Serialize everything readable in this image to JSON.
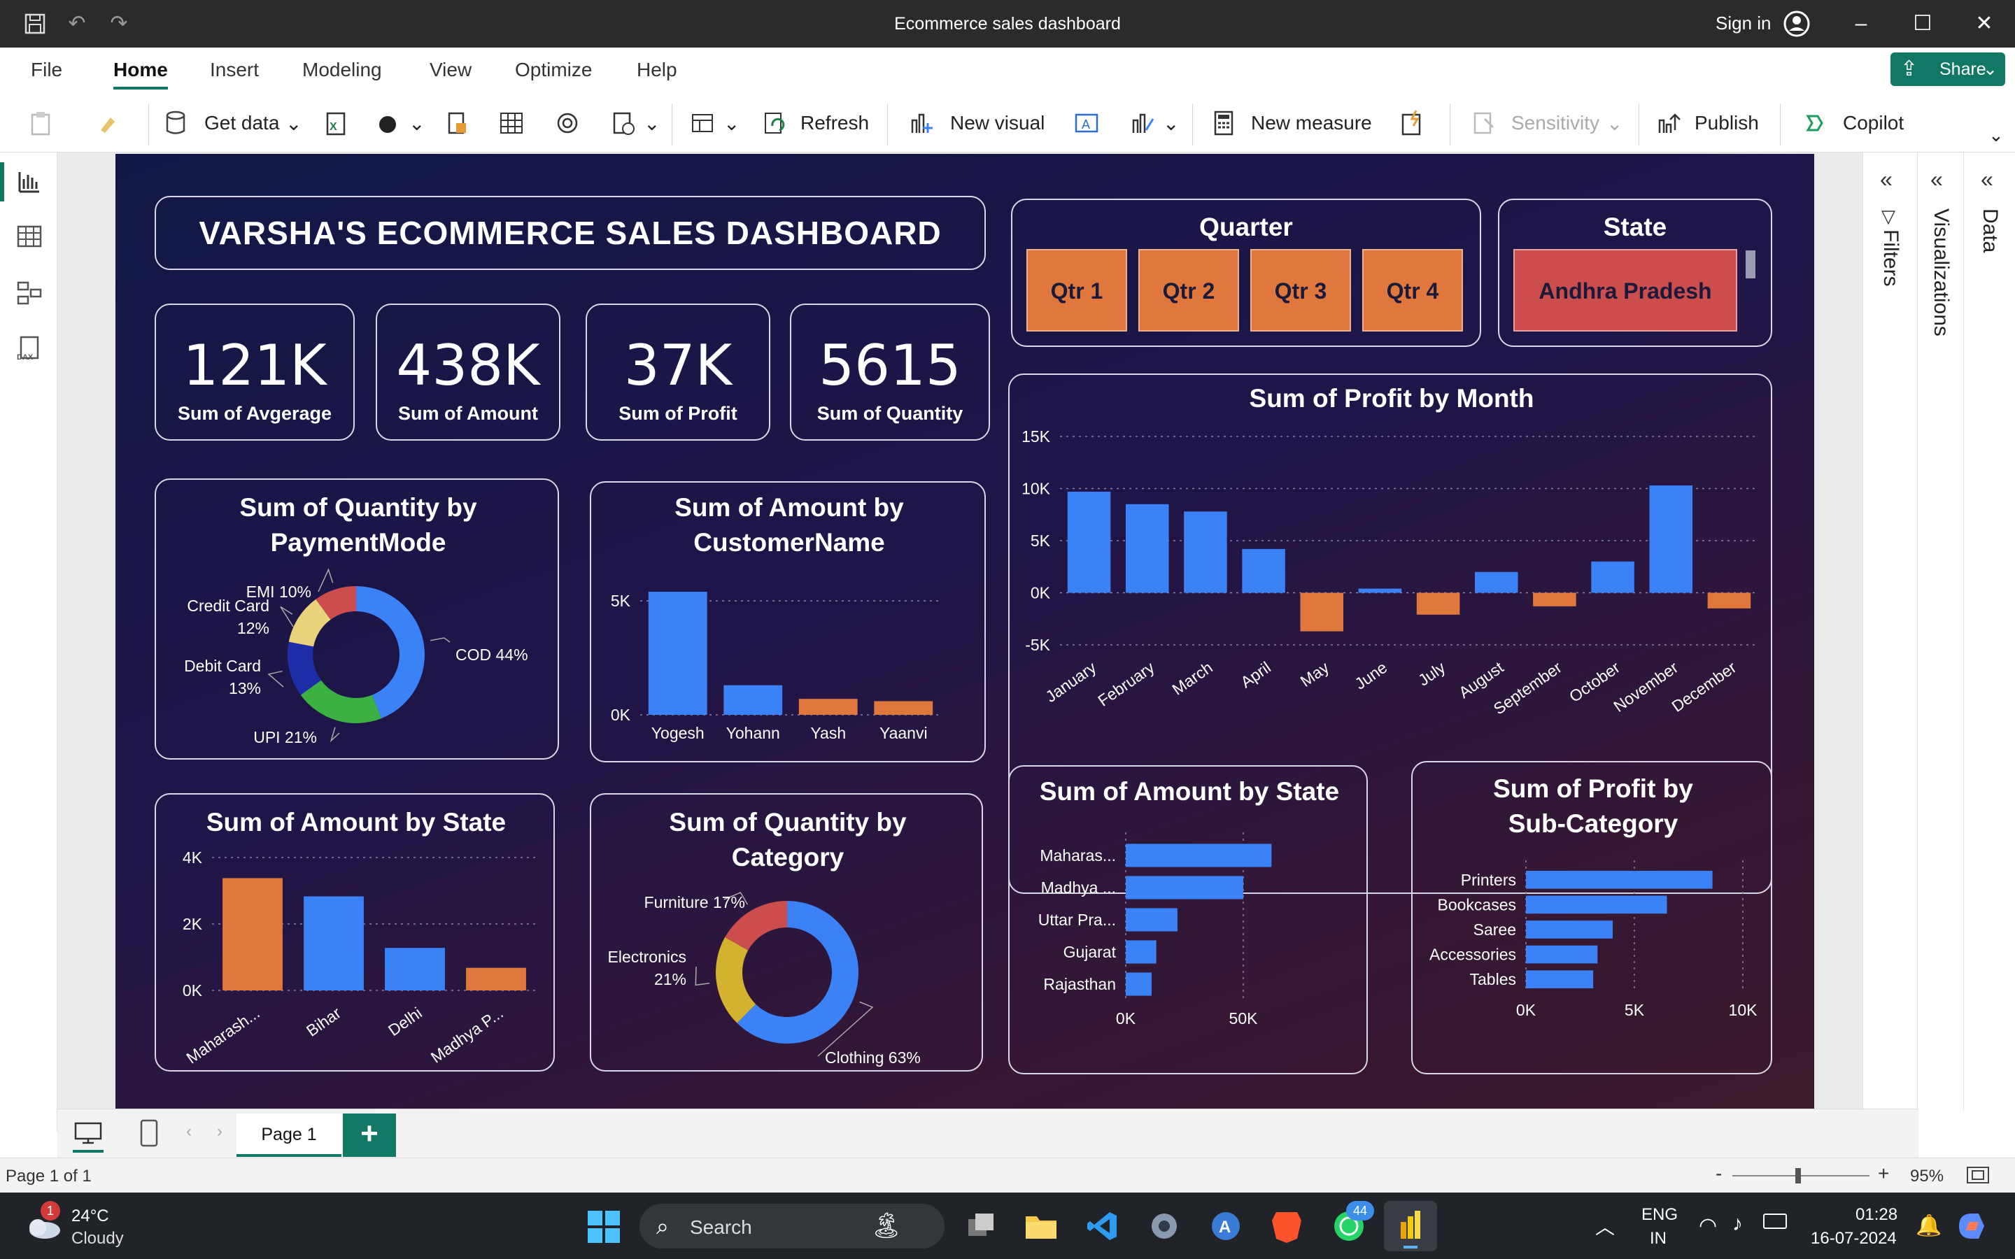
{
  "window": {
    "title": "Ecommerce sales dashboard",
    "sign_in": "Sign in"
  },
  "menu": [
    "File",
    "Home",
    "Insert",
    "Modeling",
    "View",
    "Optimize",
    "Help"
  ],
  "share_label": "Share",
  "ribbon": {
    "get_data": "Get data",
    "refresh": "Refresh",
    "new_visual": "New visual",
    "new_measure": "New measure",
    "sensitivity": "Sensitivity",
    "publish": "Publish",
    "copilot": "Copilot"
  },
  "dashboard": {
    "title": "VARSHA'S ECOMMERCE SALES DASHBOARD",
    "kpis": [
      {
        "value": "121K",
        "label": "Sum of Avgerage"
      },
      {
        "value": "438K",
        "label": "Sum of Amount"
      },
      {
        "value": "37K",
        "label": "Sum of Profit"
      },
      {
        "value": "5615",
        "label": "Sum of Quantity"
      }
    ],
    "quarter_slicer": {
      "title": "Quarter",
      "items": [
        "Qtr 1",
        "Qtr 2",
        "Qtr 3",
        "Qtr 4"
      ]
    },
    "state_slicer": {
      "title": "State",
      "selected": "Andhra Pradesh"
    }
  },
  "chart_data": [
    {
      "id": "profit-by-month",
      "type": "bar",
      "title": "Sum of Profit by Month",
      "categories": [
        "January",
        "February",
        "March",
        "April",
        "May",
        "June",
        "July",
        "August",
        "September",
        "October",
        "November",
        "December"
      ],
      "values": [
        9700,
        8500,
        7800,
        4200,
        -3700,
        400,
        -2100,
        2000,
        -1300,
        3000,
        10300,
        -1500
      ],
      "yticks": [
        "15K",
        "10K",
        "5K",
        "0K",
        "-5K"
      ],
      "ytick_values": [
        15000,
        10000,
        5000,
        0,
        -5000
      ],
      "ylim": [
        -5000,
        15000
      ],
      "grid": true
    },
    {
      "id": "quantity-by-paymentmode",
      "type": "pie",
      "title": "Sum of Quantity by PaymentMode",
      "labels": [
        "COD 44%",
        "UPI 21%",
        "Debit Card 13%",
        "Credit Card 12%",
        "EMI 10%"
      ],
      "values": [
        44,
        21,
        13,
        12,
        10
      ],
      "colors": [
        "#3b82f6",
        "#3bb143",
        "#1e2ca8",
        "#e8d27a",
        "#cd4c4c"
      ]
    },
    {
      "id": "amount-by-customer",
      "type": "bar",
      "title": "Sum of Amount by CustomerName",
      "categories": [
        "Yogesh",
        "Yohann",
        "Yash",
        "Yaanvi"
      ],
      "values": [
        5400,
        1300,
        700,
        600
      ],
      "colors": [
        "#3b82f6",
        "#3b82f6",
        "#e0773d",
        "#e0773d"
      ],
      "yticks": [
        "5K",
        "0K"
      ],
      "ytick_values": [
        5000,
        0
      ],
      "ylim": [
        0,
        5400
      ],
      "grid": true
    },
    {
      "id": "amount-by-state-vertical",
      "type": "bar",
      "title": "Sum of Amount by State",
      "categories": [
        "Maharash...",
        "Bihar",
        "Delhi",
        "Madhya P..."
      ],
      "values": [
        3380,
        2830,
        1280,
        680
      ],
      "colors": [
        "#e0773d",
        "#3b82f6",
        "#3b82f6",
        "#e0773d"
      ],
      "yticks": [
        "4K",
        "2K",
        "0K"
      ],
      "ytick_values": [
        4000,
        2000,
        0
      ],
      "ylim": [
        0,
        4000
      ],
      "grid": true
    },
    {
      "id": "quantity-by-category",
      "type": "pie",
      "title": "Sum of Quantity by Category",
      "labels": [
        "Clothing 63%",
        "Electronics 21%",
        "Furniture 17%"
      ],
      "values": [
        63,
        21,
        17
      ],
      "colors": [
        "#3b82f6",
        "#d4b12f",
        "#cd4c4c"
      ]
    },
    {
      "id": "amount-by-state-horizontal",
      "type": "bar",
      "title": "Sum of Amount by State",
      "categories": [
        "Maharas...",
        "Madhya ...",
        "Uttar Pra...",
        "Gujarat",
        "Rajasthan"
      ],
      "values": [
        62000,
        50000,
        22000,
        13000,
        11000
      ],
      "xticks": [
        "0K",
        "50K"
      ],
      "xtick_values": [
        0,
        50000
      ],
      "xlim": [
        0,
        75000
      ],
      "grid": true
    },
    {
      "id": "profit-by-subcategory",
      "type": "bar",
      "title": "Sum of Profit by Sub-Category",
      "categories": [
        "Printers",
        "Bookcases",
        "Saree",
        "Accessories",
        "Tables"
      ],
      "values": [
        8600,
        6500,
        4000,
        3300,
        3100
      ],
      "xticks": [
        "0K",
        "5K",
        "10K"
      ],
      "xtick_values": [
        0,
        5000,
        10000
      ],
      "xlim": [
        0,
        10000
      ],
      "grid": true
    }
  ],
  "side_panes": {
    "filters": "Filters",
    "visualizations": "Visualizations",
    "data": "Data"
  },
  "pages": {
    "current": "Page 1",
    "status": "Page 1 of 1",
    "zoom": "95%"
  },
  "taskbar": {
    "weather_temp": "24°C",
    "weather_desc": "Cloudy",
    "weather_badge": "1",
    "search": "Search",
    "whatsapp_badge": "44",
    "lang1": "ENG",
    "lang2": "IN",
    "time": "01:28",
    "date": "16-07-2024"
  },
  "colors": {
    "accent": "#117865",
    "bar_positive": "#3b82f6",
    "bar_negative": "#e0773d"
  }
}
